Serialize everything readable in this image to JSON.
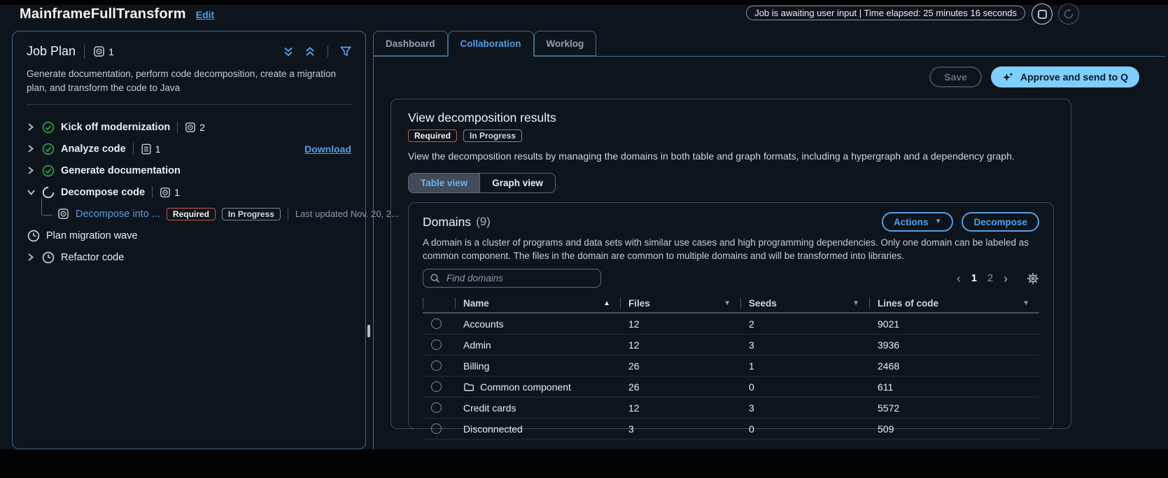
{
  "header": {
    "title": "MainframeFullTransform",
    "edit_label": "Edit",
    "status_text": "Job is awaiting user input | Time elapsed: 25 minutes 16 seconds"
  },
  "job_plan": {
    "title": "Job Plan",
    "count": "1",
    "description": "Generate documentation, perform code decomposition, create a migration plan, and transform the code to Java",
    "items": [
      {
        "label": "Kick off modernization",
        "status": "complete",
        "count": "2"
      },
      {
        "label": "Analyze code",
        "status": "complete",
        "count": "1",
        "action_label": "Download"
      },
      {
        "label": "Generate documentation",
        "status": "complete"
      },
      {
        "label": "Decompose code",
        "status": "in-progress",
        "count": "1"
      },
      {
        "label": "Decompose into ...",
        "status": "in-progress",
        "badges": [
          {
            "label": "Required"
          },
          {
            "label": "In Progress"
          }
        ],
        "meta": "Last updated Nov. 20, 2..."
      },
      {
        "label": "Plan migration wave",
        "status": "pending"
      },
      {
        "label": "Refactor code",
        "status": "pending"
      }
    ]
  },
  "tabs": [
    {
      "label": "Dashboard",
      "active": false
    },
    {
      "label": "Collaboration",
      "active": true
    },
    {
      "label": "Worklog",
      "active": false
    }
  ],
  "toolbar": {
    "save_label": "Save",
    "approve_label": "Approve and send to Q"
  },
  "results": {
    "title": "View decomposition results",
    "badges": [
      {
        "label": "Required",
        "type": "error"
      },
      {
        "label": "In Progress",
        "type": "neutral"
      }
    ],
    "description": "View the decomposition results by managing the domains in both table and graph formats, including a hypergraph and a dependency graph.",
    "view_toggle": [
      {
        "label": "Table view",
        "active": true
      },
      {
        "label": "Graph view",
        "active": false
      }
    ]
  },
  "domains": {
    "title": "Domains",
    "count_text": "(9)",
    "actions_label": "Actions",
    "decompose_label": "Decompose",
    "description": "A domain is a cluster of programs and data sets with similar use cases and high programming dependencies. Only one domain can be labeled as common component. The files in the domain are common to multiple domains and will be transformed into libraries.",
    "search_placeholder": "Find domains",
    "pagination": {
      "prev": "‹",
      "pages": [
        "1",
        "2"
      ],
      "active_page": "1",
      "next": "›"
    },
    "columns": [
      {
        "label": "Name",
        "sort": "asc"
      },
      {
        "label": "Files",
        "sort": "none"
      },
      {
        "label": "Seeds",
        "sort": "none"
      },
      {
        "label": "Lines of code",
        "sort": "none"
      }
    ],
    "rows": [
      {
        "name": "Accounts",
        "files": "12",
        "seeds": "2",
        "lines_of_code": "9021"
      },
      {
        "name": "Admin",
        "files": "12",
        "seeds": "3",
        "lines_of_code": "3936"
      },
      {
        "name": "Billing",
        "files": "26",
        "seeds": "1",
        "lines_of_code": "2468"
      },
      {
        "name": "Common component",
        "folder_icon": true,
        "files": "26",
        "seeds": "0",
        "lines_of_code": "611"
      },
      {
        "name": "Credit cards",
        "files": "12",
        "seeds": "3",
        "lines_of_code": "5572"
      },
      {
        "name": "Disconnected",
        "files": "3",
        "seeds": "0",
        "lines_of_code": "509"
      }
    ]
  },
  "icons": {
    "sort_asc": "▲",
    "caret_down": "▼"
  },
  "colors": {
    "accent_blue": "#539fe5",
    "approve_button_bg": "#7dcfff",
    "success_green": "#2ea04a",
    "error_red": "#cd5553",
    "muted_gray": "#8d99a8",
    "panel_border_blue": "#3d6b8f",
    "panel_border_gray": "#424650",
    "background": "#0d141c"
  }
}
